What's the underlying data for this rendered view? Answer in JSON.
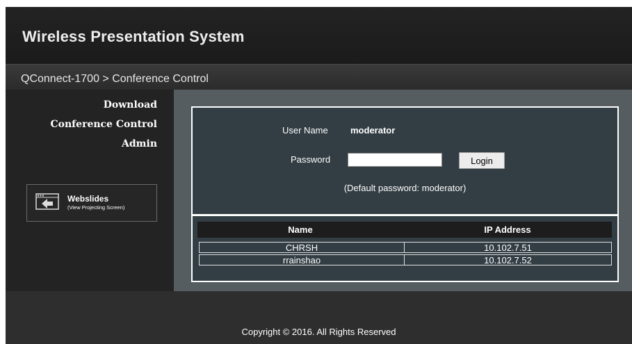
{
  "header": {
    "title": "Wireless Presentation System"
  },
  "breadcrumb": {
    "text": "QConnect-1700 > Conference Control"
  },
  "sidebar": {
    "items": [
      {
        "label": "Download"
      },
      {
        "label": "Conference Control"
      },
      {
        "label": "Admin"
      }
    ],
    "webslides": {
      "icon": "projector-screen-icon",
      "title": "Webslides",
      "subtitle": "(View Projecting Screen)"
    }
  },
  "login": {
    "user_name_label": "User Name",
    "user_name_value": "moderator",
    "password_label": "Password",
    "password_value": "",
    "login_button": "Login",
    "hint": "(Default password: moderator)"
  },
  "clients": {
    "columns": [
      "Name",
      "IP Address"
    ],
    "rows": [
      [
        "CHRSH",
        "10.102.7.51"
      ],
      [
        "rrainshao",
        "10.102.7.52"
      ]
    ]
  },
  "footer": {
    "copyright": "Copyright © 2016. All Rights Reserved"
  },
  "colors": {
    "background": "#2e2e2e",
    "panel": "#323e44",
    "main_area": "#555d61",
    "text": "#ffffff"
  }
}
